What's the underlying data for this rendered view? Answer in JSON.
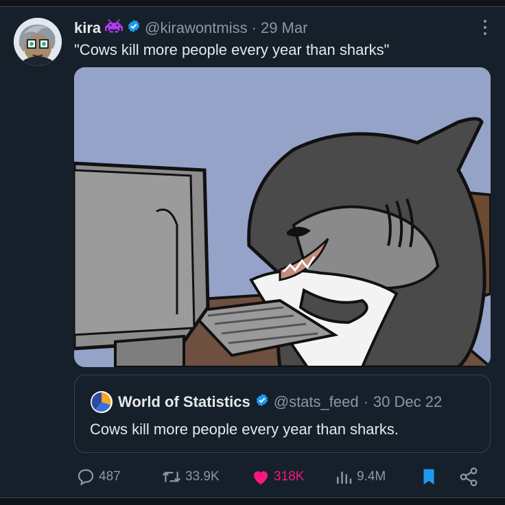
{
  "tweet": {
    "author_name": "kira",
    "author_handle": "@kirawontmiss",
    "separator": "·",
    "date": "29 Mar",
    "text": "\"Cows kill more people every year than sharks\"",
    "emoji_icon": "space-invader-icon",
    "verified_icon": "verified-badge-icon",
    "verified_color": "#1d9bf0",
    "emoji_color": "#b43cf0"
  },
  "quote": {
    "author_name": "World of Statistics",
    "author_handle": "@stats_feed",
    "separator": "·",
    "date": "30 Dec 22",
    "text": "Cows kill more people every year than sharks."
  },
  "actions": {
    "replies": "487",
    "reposts": "33.9K",
    "likes": "318K",
    "views": "9.4M",
    "bookmark_color": "#1d9bf0",
    "like_color": "#f91880",
    "muted_color": "#8b98a5"
  },
  "theme": {
    "background": "#15202b",
    "border": "#38444d",
    "text": "#e7e9ea"
  }
}
